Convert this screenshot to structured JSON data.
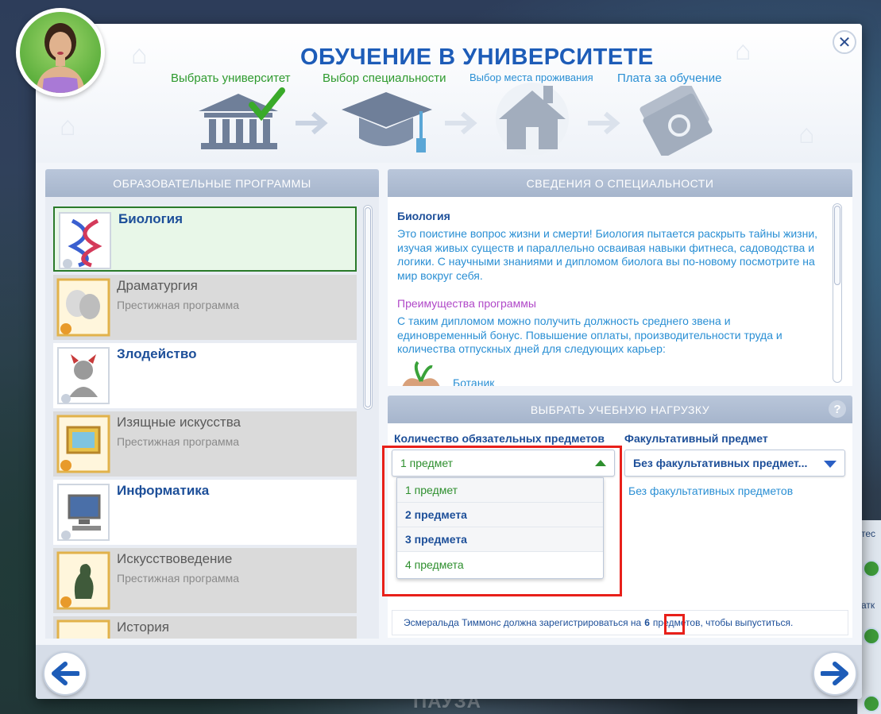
{
  "dialog": {
    "title": "Обучение в университете",
    "close_glyph": "✕"
  },
  "steps": [
    {
      "label": "Выбрать университет",
      "state": "done",
      "icon": "university-columns-icon"
    },
    {
      "label": "Выбор специальности",
      "state": "done",
      "icon": "graduation-cap-icon"
    },
    {
      "label": "Выбор места проживания",
      "state": "todo",
      "icon": "house-icon"
    },
    {
      "label": "Плата за обучение",
      "state": "todo",
      "icon": "money-bills-icon"
    }
  ],
  "programs_panel": {
    "header": "Образовательные программы",
    "items": [
      {
        "name": "Биология",
        "subtitle": "",
        "type": "selected",
        "icon": "dna-diploma-icon"
      },
      {
        "name": "Драматургия",
        "subtitle": "Престижная программа",
        "type": "prestige",
        "icon": "theater-masks-diploma-icon"
      },
      {
        "name": "Злодейство",
        "subtitle": "",
        "type": "normal",
        "icon": "villain-diploma-icon"
      },
      {
        "name": "Изящные искусства",
        "subtitle": "Престижная программа",
        "type": "prestige",
        "icon": "painting-diploma-icon"
      },
      {
        "name": "Информатика",
        "subtitle": "",
        "type": "normal",
        "icon": "computer-diploma-icon"
      },
      {
        "name": "Искусствоведение",
        "subtitle": "Престижная программа",
        "type": "prestige",
        "icon": "statue-diploma-icon"
      },
      {
        "name": "История",
        "subtitle": "",
        "type": "prestige",
        "icon": "history-diploma-icon"
      }
    ]
  },
  "info_panel": {
    "header": "Сведения о специальности",
    "title": "Биология",
    "description": "Это поистине вопрос жизни и смерти! Биология пытается раскрыть тайны жизни, изучая живых существ и параллельно осваивая навыки фитнеса, садоводства и логики. С научными знаниями и дипломом биолога вы по-новому посмотрите на мир вокруг себя.",
    "advantages_title": "Преимущества программы",
    "advantages": "С таким дипломом можно получить должность среднего звена и единовременный бонус. Повышение оплаты, производительности труда и количества отпускных дней для следующих карьер:",
    "career": "Ботаник"
  },
  "load_panel": {
    "header": "Выбрать учебную нагрузку",
    "help_glyph": "?",
    "required_label": "Количество обязательных предметов",
    "required_value": "1 предмет",
    "required_options": [
      "1 предмет",
      "2 предмета",
      "3 предмета",
      "4 предмета"
    ],
    "elective_label": "Факультативный предмет",
    "elective_value": "Без факультативных предмет...",
    "elective_current": "Без факультативных предметов",
    "note_before": "Эсмеральда Тиммонс должна зарегистрироваться на",
    "note_number": "6",
    "note_after": "предметов, чтобы выпуститься."
  },
  "background": {
    "pause_label": "ПАУЗА",
    "side_text_1": "тес",
    "side_text_2": "атк"
  },
  "colors": {
    "accent_blue": "#1d5cb8",
    "done_green": "#2e9a2e",
    "link_blue": "#2a8fd4",
    "highlight_red": "#e8201a"
  }
}
